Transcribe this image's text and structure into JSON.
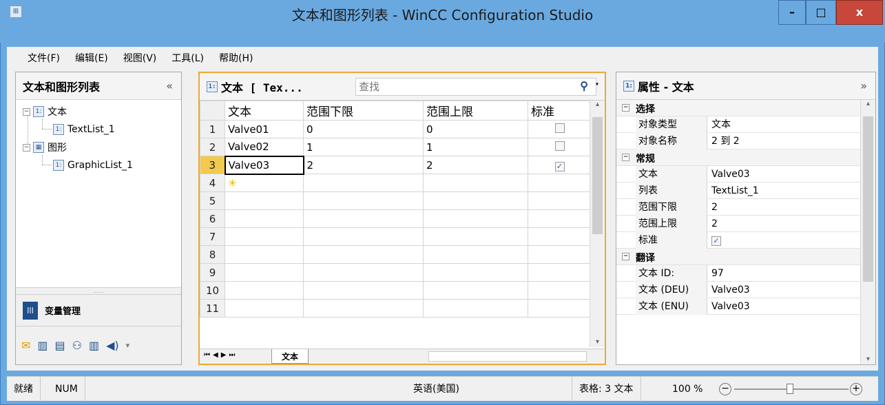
{
  "window": {
    "title": "文本和图形列表 - WinCC Configuration Studio",
    "min_label": "–",
    "max_label": "□",
    "close_label": "x"
  },
  "menu": [
    "文件(F)",
    "编辑(E)",
    "视图(V)",
    "工具(L)",
    "帮助(H)"
  ],
  "left_panel": {
    "title": "文本和图形列表",
    "collapse_label": "«",
    "tree": [
      {
        "label": "文本",
        "level": 0
      },
      {
        "label": "TextList_1",
        "level": 1
      },
      {
        "label": "图形",
        "level": 0
      },
      {
        "label": "GraphicList_1",
        "level": 1
      }
    ],
    "grip": "......",
    "nav_label": "变量管理"
  },
  "center_panel": {
    "title": "文本 [ Tex...",
    "search_placeholder": "查找",
    "columns": [
      "文本",
      "范围下限",
      "范围上限",
      "标准"
    ],
    "rows": [
      {
        "num": "1",
        "text": "Valve01",
        "low": "0",
        "high": "0",
        "std": false
      },
      {
        "num": "2",
        "text": "Valve02",
        "low": "1",
        "high": "1",
        "std": false
      },
      {
        "num": "3",
        "text": "Valve03",
        "low": "2",
        "high": "2",
        "std": true
      },
      {
        "num": "4",
        "text": "",
        "low": "",
        "high": "",
        "std": null
      },
      {
        "num": "5"
      },
      {
        "num": "6"
      },
      {
        "num": "7"
      },
      {
        "num": "8"
      },
      {
        "num": "9"
      },
      {
        "num": "10"
      },
      {
        "num": "11"
      }
    ],
    "sheet_tab": "文本"
  },
  "right_panel": {
    "title": "属性 - 文本",
    "expand_label": "»",
    "categories": [
      {
        "name": "选择",
        "props": [
          [
            "对象类型",
            "文本"
          ],
          [
            "对象名称",
            "2 到 2"
          ]
        ]
      },
      {
        "name": "常规",
        "props": [
          [
            "文本",
            "Valve03"
          ],
          [
            "列表",
            "TextList_1"
          ],
          [
            "范围下限",
            "2"
          ],
          [
            "范围上限",
            "2"
          ],
          [
            "标准",
            "✓"
          ]
        ]
      },
      {
        "name": "翻译",
        "props": [
          [
            "文本 ID:",
            "97"
          ],
          [
            "文本 (DEU)",
            "Valve03"
          ],
          [
            "文本 (ENU)",
            "Valve03"
          ]
        ]
      }
    ]
  },
  "status": {
    "ready": "就绪",
    "num": "NUM",
    "language": "英语(美国)",
    "table_info": "表格: 3 文本",
    "zoom": "100 %"
  }
}
